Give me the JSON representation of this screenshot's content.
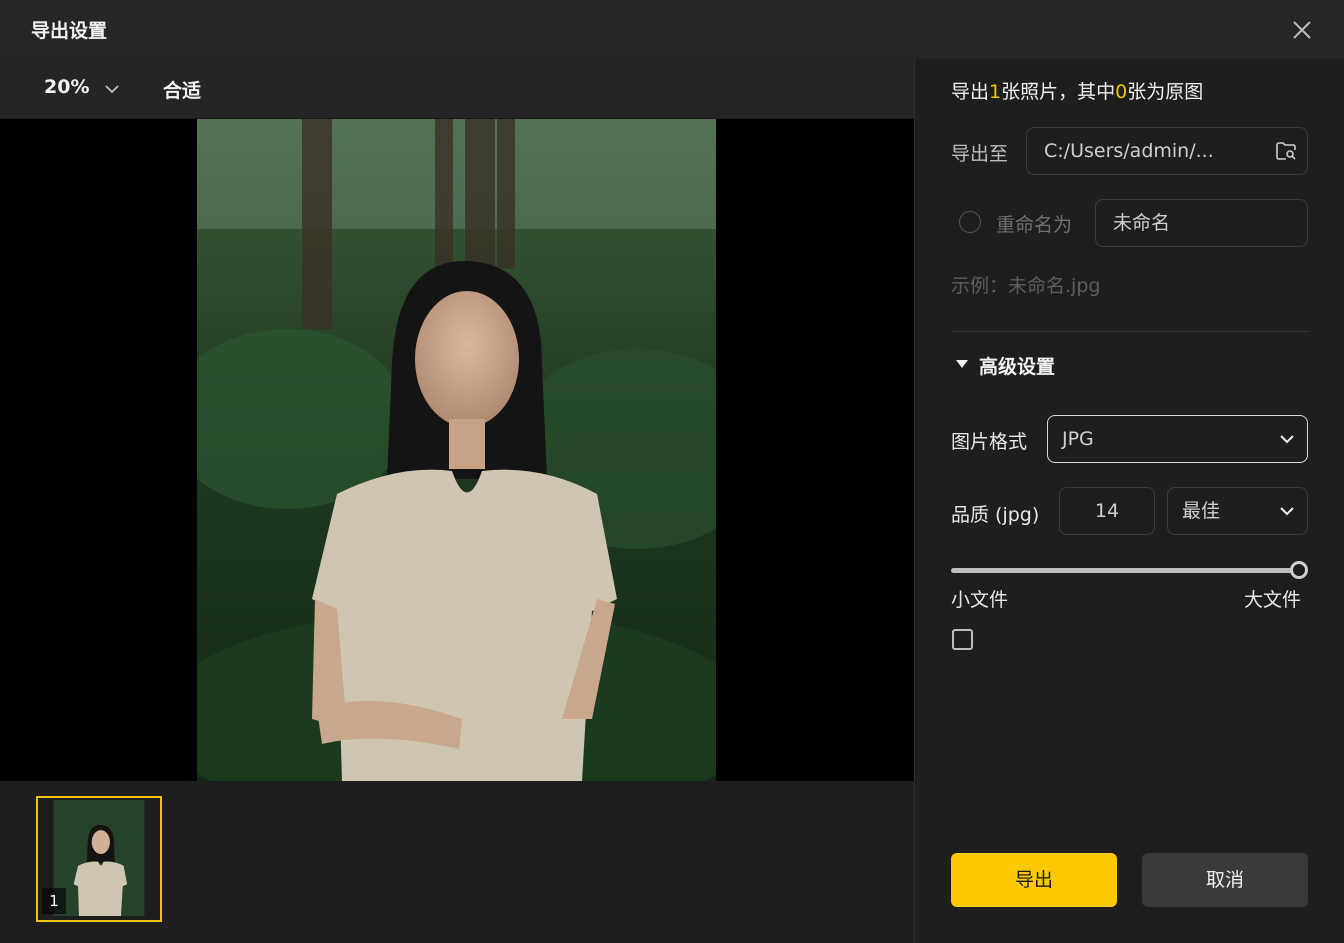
{
  "dialog": {
    "title": "导出设置"
  },
  "preview": {
    "zoom": "20%",
    "fit_label": "合适",
    "thumbnail_index": "1"
  },
  "panel": {
    "summary": {
      "prefix": "导出",
      "count": "1",
      "middle": "张照片，其中",
      "original_count": "0",
      "suffix": "张为原图"
    },
    "export_to_label": "导出至",
    "export_path": "C:/Users/admin/...",
    "rename_label": "重命名为",
    "rename_value": "未命名",
    "example": "示例：未命名.jpg",
    "advanced_title": "高级设置",
    "format_label": "图片格式",
    "format_value": "JPG",
    "quality_label": "品质 (jpg)",
    "quality_value": "14",
    "quality_preset": "最佳",
    "quality_level": 1.0,
    "slider_min_label": "小文件",
    "slider_max_label": "大文件",
    "checkbox_checked": false
  },
  "buttons": {
    "export": "导出",
    "cancel": "取消"
  },
  "colors": {
    "accent": "#fcc800",
    "background": "#1e1e1e",
    "titlebar": "#262626"
  }
}
